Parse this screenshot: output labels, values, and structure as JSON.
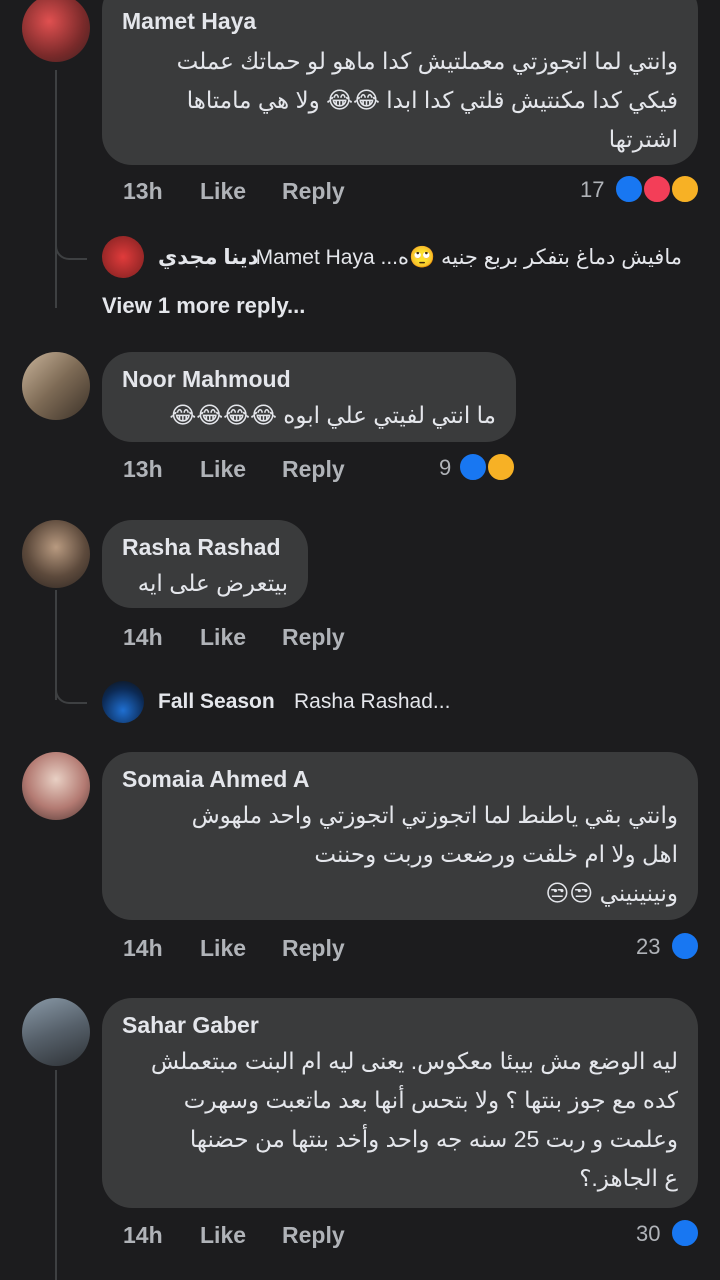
{
  "actions": {
    "like": "Like",
    "reply": "Reply"
  },
  "comments": [
    {
      "name": "Mamet Haya",
      "lines": [
        "وانتي لما اتجوزتي معملتيش كدا ماهو لو حماتك عملت",
        "فيكي كدا مكنتيش قلتي كدا ابدا 😂😂 ولا هي مامتاها",
        "اشترتها"
      ],
      "time": "13h",
      "reactions": "17"
    },
    {
      "name": "Noor Mahmoud",
      "lines": [
        "ما انتي لفيتي علي ابوه 😂😂😂😂"
      ],
      "time": "13h",
      "reactions": "9"
    },
    {
      "name": "Rasha Rashad",
      "lines": [
        "بيتعرض على ايه"
      ],
      "time": "14h",
      "reactions": ""
    },
    {
      "name": "Somaia Ahmed A",
      "lines": [
        "وانتي بقي ياطنط لما اتجوزتي اتجوزتي واحد ملهوش",
        "اهل ولا ام خلفت ورضعت وربت وحننت",
        "ونينينيني 😒😒"
      ],
      "time": "14h",
      "reactions": "23"
    },
    {
      "name": "Sahar Gaber",
      "lines": [
        "ليه الوضع مش بيبئا معكوس. يعنى ليه ام البنت مبتعملش",
        "كده مع جوز بنتها ؟ ولا بتحس أنها بعد ماتعبت وسهرت",
        "وعلمت و ربت 25 سنه جه واحد وأخد بنتها من حضنها",
        "ع الجاهز.؟"
      ],
      "time": "14h",
      "reactions": "30"
    }
  ],
  "replies": {
    "r1": {
      "preview": "مافيش دماغ بتفكر بربع جنيه 🙄ه... Mamet Haya",
      "name": "دينا مجدي"
    },
    "more": "View 1 more reply...",
    "r3": {
      "name": "Fall Season",
      "preview": "Rasha Rashad..."
    }
  },
  "colors": {
    "background": "#1c1c1e",
    "bubble": "#3a3b3c",
    "text": "#e4e6eb",
    "meta": "#b0b3b8",
    "like": "#1877f2",
    "love": "#f33e58",
    "haha": "#f7b125"
  },
  "icons": [
    "like-reaction-icon",
    "love-reaction-icon",
    "care-reaction-icon",
    "haha-reaction-icon"
  ]
}
